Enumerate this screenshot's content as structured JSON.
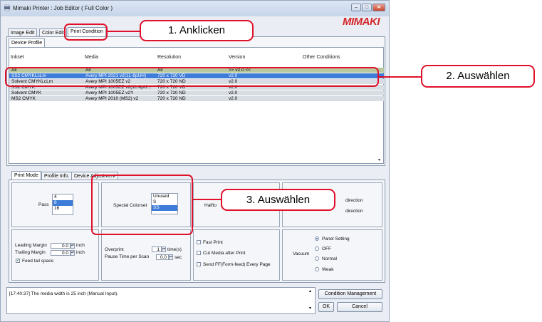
{
  "window": {
    "title": "Mimaki Printer : Job Editor ( Full Color )",
    "logo": "MIMAKI",
    "min": "–",
    "max": "□",
    "close": "✕"
  },
  "tabs": [
    "Image Edit",
    "Color Edit",
    "Print Condition"
  ],
  "subtab": "Device Profile",
  "profile_table": {
    "headers": [
      "Inkset",
      "Media",
      "Resolution",
      "Version",
      "Other Conditions"
    ],
    "rows": [
      {
        "inkset": "All",
        "media": "All",
        "resolution": "All",
        "version": ">> v2.0 <<"
      },
      {
        "inkset": "SS2 CMYKLcLm",
        "media": "Avery MPI 2021 v2(1L-8pUH)",
        "resolution": "720 x 720 VD",
        "version": "v2.0"
      },
      {
        "inkset": "Solvent CMYKLcLm",
        "media": "Avery MPI 1005EZ v2",
        "resolution": "720 x 720 ND",
        "version": "v2.0"
      },
      {
        "inkset": "SS2 CMYK",
        "media": "Avery MPI 1005EZ v2(1L-8pU...",
        "resolution": "720 x 720 VD",
        "version": "v2.0"
      },
      {
        "inkset": "Solvent CMYK",
        "media": "Avery MPI 1005EZ v2Y",
        "resolution": "720 x 720 ND",
        "version": "v2.0"
      },
      {
        "inkset": "MS2 CMYK",
        "media": "Avery MPI 2010 (MS2) v2",
        "resolution": "720 x 720 ND",
        "version": "v2.0"
      }
    ]
  },
  "lower_tabs": [
    "Print Mode",
    "Profile Info.",
    "Device Adjustment"
  ],
  "pass": {
    "label": "Pass",
    "options": [
      "4",
      "8",
      "16"
    ],
    "selected": "8"
  },
  "special_colorset": {
    "label": "Special Colorset",
    "options": [
      "Unused",
      "S",
      "SS"
    ],
    "selected": "SS"
  },
  "halftone": {
    "label": "Halfto"
  },
  "direction": {
    "option1": "direction",
    "option2": "direction"
  },
  "margins": {
    "leading_label": "Leading Margin",
    "leading_value": "0.0",
    "trailing_label": "Trailing Margin",
    "trailing_value": "0.0",
    "unit": "inch",
    "feed_tail": "Feed tail space"
  },
  "overprint": {
    "label": "Overprint",
    "value": "1",
    "unit": "time(s)",
    "pause_label": "Pause Time per Scan",
    "pause_value": "0.0",
    "pause_unit": "sec"
  },
  "options": {
    "fast_print": "Fast Print",
    "cut_media": "Cut Media after Print",
    "send_ff": "Send FF(Form-feed) Every Page"
  },
  "vacuum": {
    "label": "Vacuum",
    "options": [
      "Panel Setting",
      "OFF",
      "Normal",
      "Weak"
    ],
    "selected": "Panel Setting"
  },
  "log": "[17:40:37] The media width is 25 inch (Manual Input).",
  "buttons": {
    "condition": "Condition Management",
    "ok": "OK",
    "cancel": "Cancel"
  },
  "callouts": {
    "c1": "1. Anklicken",
    "c2": "2. Auswählen",
    "c3": "3. Auswählen"
  },
  "colors": {
    "annotation": "#e0112b",
    "selection": "#3d7cd8",
    "logo": "#d4262b"
  }
}
